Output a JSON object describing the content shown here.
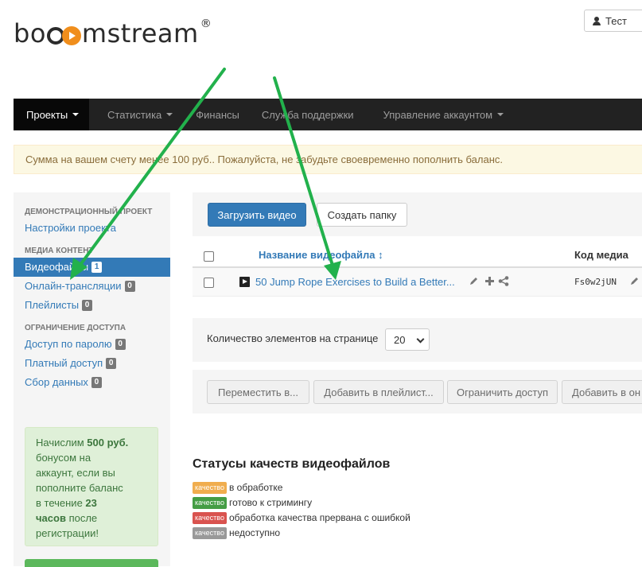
{
  "brand": {
    "name_prefix": "bo",
    "name_suffix": "mstream",
    "reg_mark": "®",
    "accent_color": "#f08e1c"
  },
  "user": {
    "label": "Тест"
  },
  "navbar": {
    "items": [
      {
        "label": "Проекты",
        "dropdown": true,
        "active": true
      },
      {
        "label": "Статистика",
        "dropdown": true
      },
      {
        "label": "Финансы"
      },
      {
        "label": "Служба поддержки"
      },
      {
        "label": "Управление аккаунтом",
        "dropdown": true
      }
    ]
  },
  "alert": {
    "text": "Сумма на вашем счету менее 100 руб.. Пожалуйста, не забудьте своевременно пополнить баланс."
  },
  "sidebar": {
    "demo_header": "ДЕМОНСТРАЦИОННЫЙ ПРОЕКТ",
    "project_settings": "Настройки проекта",
    "media_header": "МЕДИА КОНТЕНТ",
    "media_items": [
      {
        "label": "Видеофайлы",
        "count": "1",
        "active": true
      },
      {
        "label": "Онлайн-трансляции",
        "count": "0"
      },
      {
        "label": "Плейлисты",
        "count": "0"
      }
    ],
    "access_header": "ОГРАНИЧЕНИЕ ДОСТУПА",
    "access_items": [
      {
        "label": "Доступ по паролю",
        "count": "0"
      },
      {
        "label": "Платный доступ",
        "count": "0"
      },
      {
        "label": "Сбор данных",
        "count": "0"
      }
    ],
    "bonus": {
      "l1": "Начислим ",
      "amount": "500 руб.",
      "l2": "бонусом на",
      "l3": "аккаунт, если вы",
      "l4": "пополните баланс",
      "l5": "в течение ",
      "hours_num": "23",
      "hours_word": "часов",
      "l6": " после",
      "l7": "регистрации!"
    }
  },
  "toolbar": {
    "upload_label": "Загрузить видео",
    "create_folder_label": "Создать папку"
  },
  "table": {
    "col_name": "Название видеофайла",
    "sort_icon": "↕",
    "col_code": "Код медиа",
    "rows": [
      {
        "title": "50 Jump Rope Exercises to Build a Better...",
        "code": "Fs0w2jUN"
      }
    ]
  },
  "pager": {
    "label": "Количество элементов на странице",
    "value": "20"
  },
  "actions": {
    "move": "Переместить в...",
    "add_playlist": "Добавить в плейлист...",
    "restrict": "Ограничить доступ",
    "add_other": "Добавить в он"
  },
  "statuses": {
    "title": "Статусы качеств видеофайлов",
    "items": [
      {
        "tag": "качество",
        "text": "в обработке",
        "color": "#f0ad4e"
      },
      {
        "tag": "качество",
        "text": "готово к стримингу",
        "color": "#449d44"
      },
      {
        "tag": "качество",
        "text": "обработка качества прервана с ошибкой",
        "color": "#d9534f"
      },
      {
        "tag": "качество",
        "text": "недоступно",
        "color": "#999999"
      }
    ]
  },
  "annotation_color": "#22b14c"
}
